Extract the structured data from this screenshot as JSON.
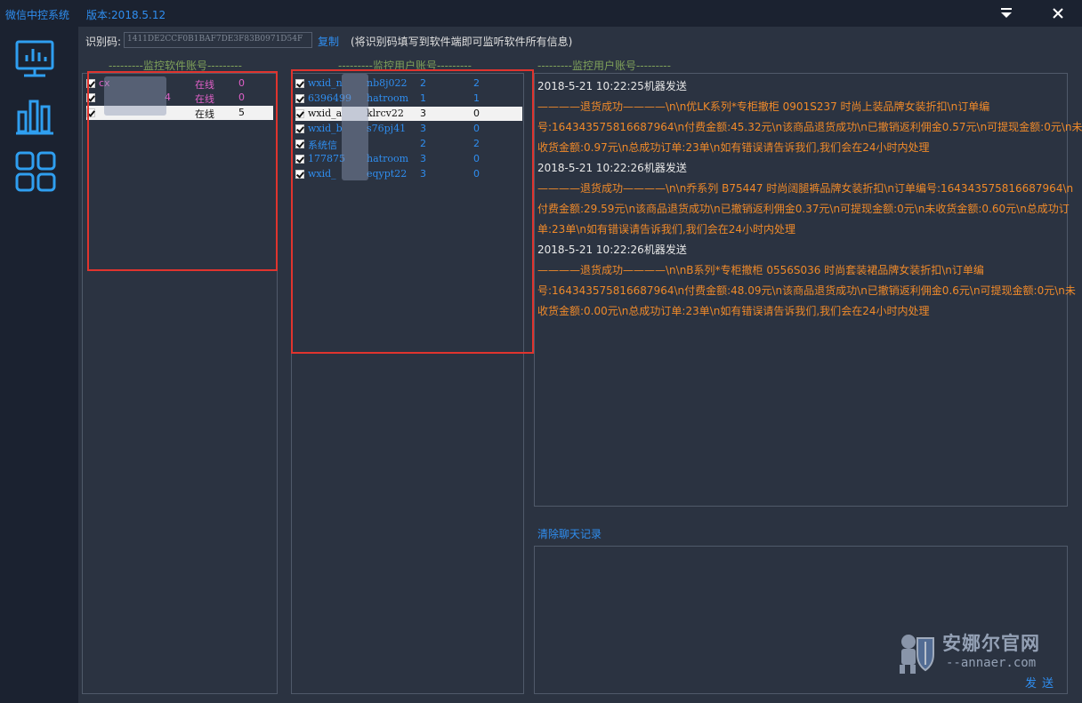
{
  "window": {
    "app_title": "微信中控系统",
    "version": "版本:2018.5.12"
  },
  "idbar": {
    "label": "识别码:",
    "code": "1411DE2CCF0B1BAF7DE3F83B0971D54F",
    "copy_label": "复制",
    "hint": "(将识别码填写到软件端即可监听软件所有信息)"
  },
  "groups": {
    "software": "---------监控软件账号---------",
    "users": "---------监控用户账号---------",
    "chat": "---------监控用户账号---------"
  },
  "accounts": [
    {
      "name": "cx",
      "status": "在线",
      "count": "0"
    },
    {
      "name": "4",
      "status": "在线",
      "count": "0"
    },
    {
      "name": "",
      "status": "在线",
      "count": "5"
    }
  ],
  "users": [
    {
      "name": "wxid_n",
      "name_tail": "nb8j022",
      "a": "2",
      "b": "2"
    },
    {
      "name": "6396499",
      "name_tail": "hatroom",
      "a": "1",
      "b": "1"
    },
    {
      "name": "wxid_a",
      "name_tail": "klrcv22",
      "a": "3",
      "b": "0"
    },
    {
      "name": "wxid_b",
      "name_tail": "s76pj41",
      "a": "3",
      "b": "0"
    },
    {
      "name": "系统信",
      "name_tail": "",
      "a": "2",
      "b": "2"
    },
    {
      "name": "177875",
      "name_tail": "hatroom",
      "a": "3",
      "b": "0"
    },
    {
      "name": "wxid_",
      "name_tail": "eqypt22",
      "a": "3",
      "b": "0"
    }
  ],
  "chat": [
    {
      "kind": "ts",
      "text": "2018-5-21 10:22:25机器发送"
    },
    {
      "kind": "msg",
      "text": "————退货成功————\\n\\n优LK系列*专柜撤柜 0901S237 时尚上装品牌女装折扣\\n订单编"
    },
    {
      "kind": "msg",
      "text": "号:164343575816687964\\n付费金额:45.32元\\n该商品退货成功\\n已撤销返利佣金0.57元\\n可提现金额:0元\\n未"
    },
    {
      "kind": "msg",
      "text": "收货金额:0.97元\\n总成功订单:23单\\n如有错误请告诉我们,我们会在24小时内处理"
    },
    {
      "kind": "ts",
      "text": "2018-5-21 10:22:26机器发送"
    },
    {
      "kind": "msg",
      "text": "————退货成功————\\n\\n乔系列 B75447 时尚阔腿裤品牌女装折扣\\n订单编号:164343575816687964\\n"
    },
    {
      "kind": "msg",
      "text": "付费金额:29.59元\\n该商品退货成功\\n已撤销返利佣金0.37元\\n可提现金额:0元\\n未收货金额:0.60元\\n总成功订"
    },
    {
      "kind": "msg",
      "text": "单:23单\\n如有错误请告诉我们,我们会在24小时内处理"
    },
    {
      "kind": "ts",
      "text": "2018-5-21 10:22:26机器发送"
    },
    {
      "kind": "msg",
      "text": "————退货成功————\\n\\nB系列*专柜撤柜 0556S036 时尚套装裙品牌女装折扣\\n订单编"
    },
    {
      "kind": "msg",
      "text": "号:164343575816687964\\n付费金额:48.09元\\n该商品退货成功\\n已撤销返利佣金0.6元\\n可提现金额:0元\\n未"
    },
    {
      "kind": "msg",
      "text": "收货金额:0.00元\\n总成功订单:23单\\n如有错误请告诉我们,我们会在24小时内处理"
    }
  ],
  "actions": {
    "clear_label": "清除聊天记录",
    "send_label": "发送"
  },
  "watermark": {
    "cn": "安娜尔官网",
    "en": "--annaer.com"
  },
  "colors": {
    "accent": "#2f8ef0",
    "message": "#f08a2a",
    "highlight_box": "#e0342e",
    "account_text": "#e060c8"
  },
  "icons": {
    "nav1": "monitor-chart-icon",
    "nav2": "bar-chart-icon",
    "nav3": "grid-apps-icon"
  }
}
